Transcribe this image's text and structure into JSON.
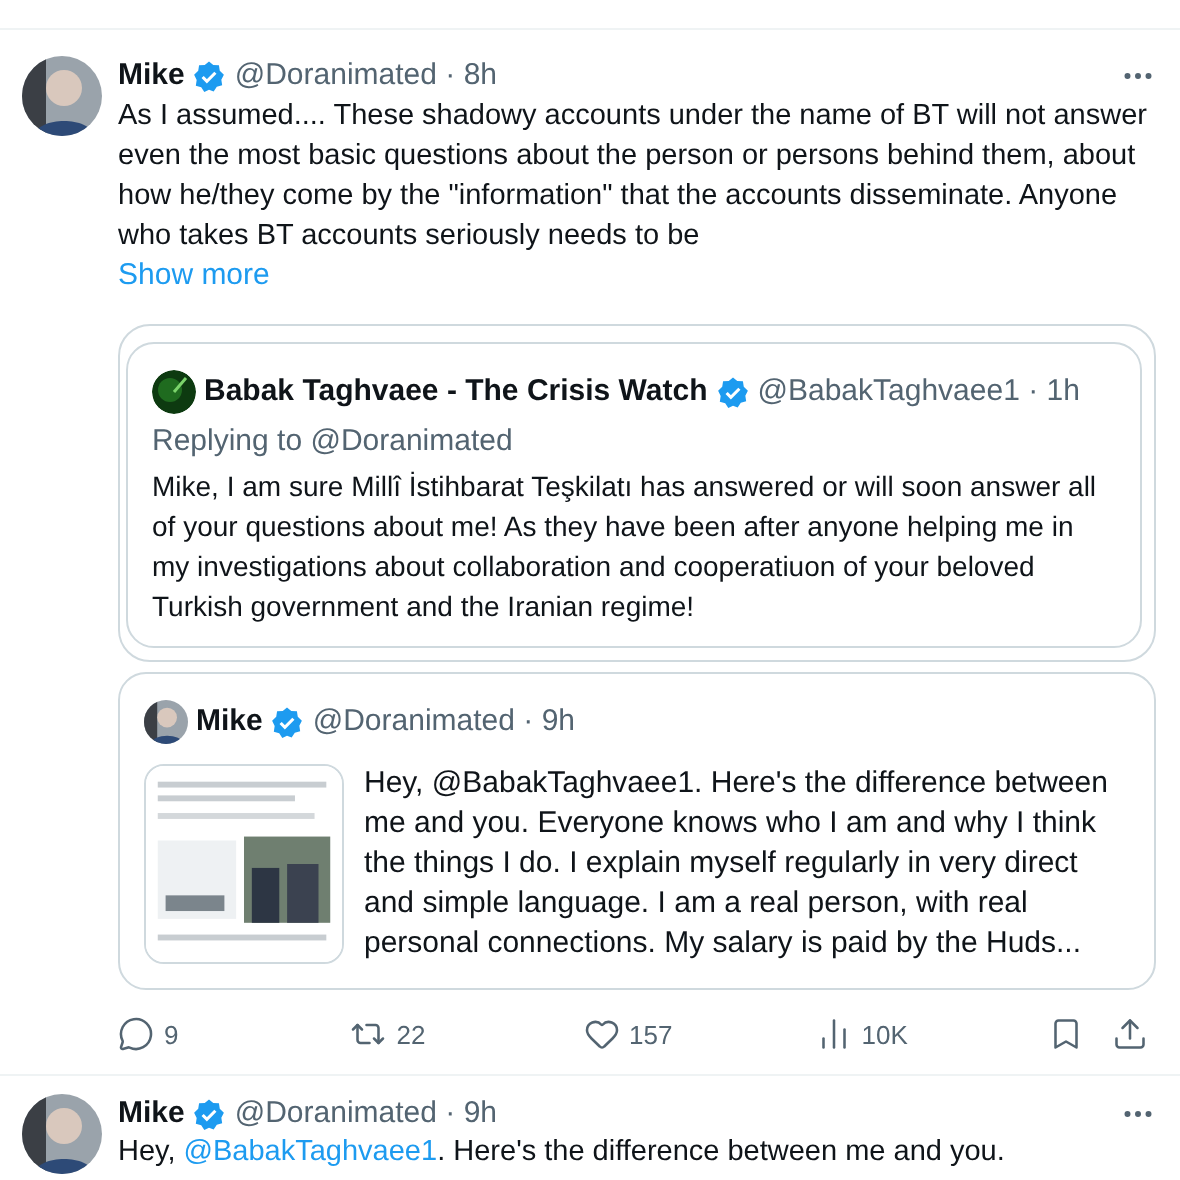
{
  "tweets": [
    {
      "author": "Mike",
      "verified": true,
      "handle": "@Doranimated",
      "separator": "·",
      "time": "8h",
      "text": "As I assumed.... These shadowy accounts under the name of BT will not answer even the most basic questions about the person or persons behind them, about how he/they come by the \"information\" that the accounts disseminate. Anyone who takes BT accounts seriously needs to be",
      "show_more": "Show more",
      "quote": {
        "outer": true,
        "author": "Babak Taghvaee - The Crisis Watch",
        "verified": true,
        "handle": "@BabakTaghvaee1",
        "separator": "·",
        "time": "1h",
        "replying_to": "Replying to @Doranimated",
        "text": "Mike, I am sure Millî İstihbarat Teşkilatı has answered or will soon answer all of your questions about me! As they have been after anyone helping me in my investigations about collaboration and cooperatiuon of your beloved Turkish government and the Iranian regime!"
      },
      "quote2": {
        "author": "Mike",
        "verified": true,
        "handle": "@Doranimated",
        "separator": "·",
        "time": "9h",
        "text": "Hey, @BabakTaghvaee1. Here's the difference between me and you. Everyone knows who I am and why I think the things I do. I explain myself regularly in very direct and simple language. I am a real person, with real personal connections.  My salary is paid by the Huds..."
      },
      "actions": [
        {
          "kind": "reply",
          "count": "9"
        },
        {
          "kind": "retweet",
          "count": "22"
        },
        {
          "kind": "like",
          "count": "157"
        },
        {
          "kind": "views",
          "count": "10K"
        },
        {
          "kind": "bookmark"
        },
        {
          "kind": "share"
        }
      ]
    },
    {
      "author": "Mike",
      "verified": true,
      "handle": "@Doranimated",
      "separator": "·",
      "time": "9h",
      "text_parts": [
        {
          "kind": "plain",
          "text": "Hey, "
        },
        {
          "kind": "mention",
          "text": "@BabakTaghvaee1"
        },
        {
          "kind": "plain",
          "text": ". Here's the difference between me and you."
        }
      ]
    }
  ]
}
